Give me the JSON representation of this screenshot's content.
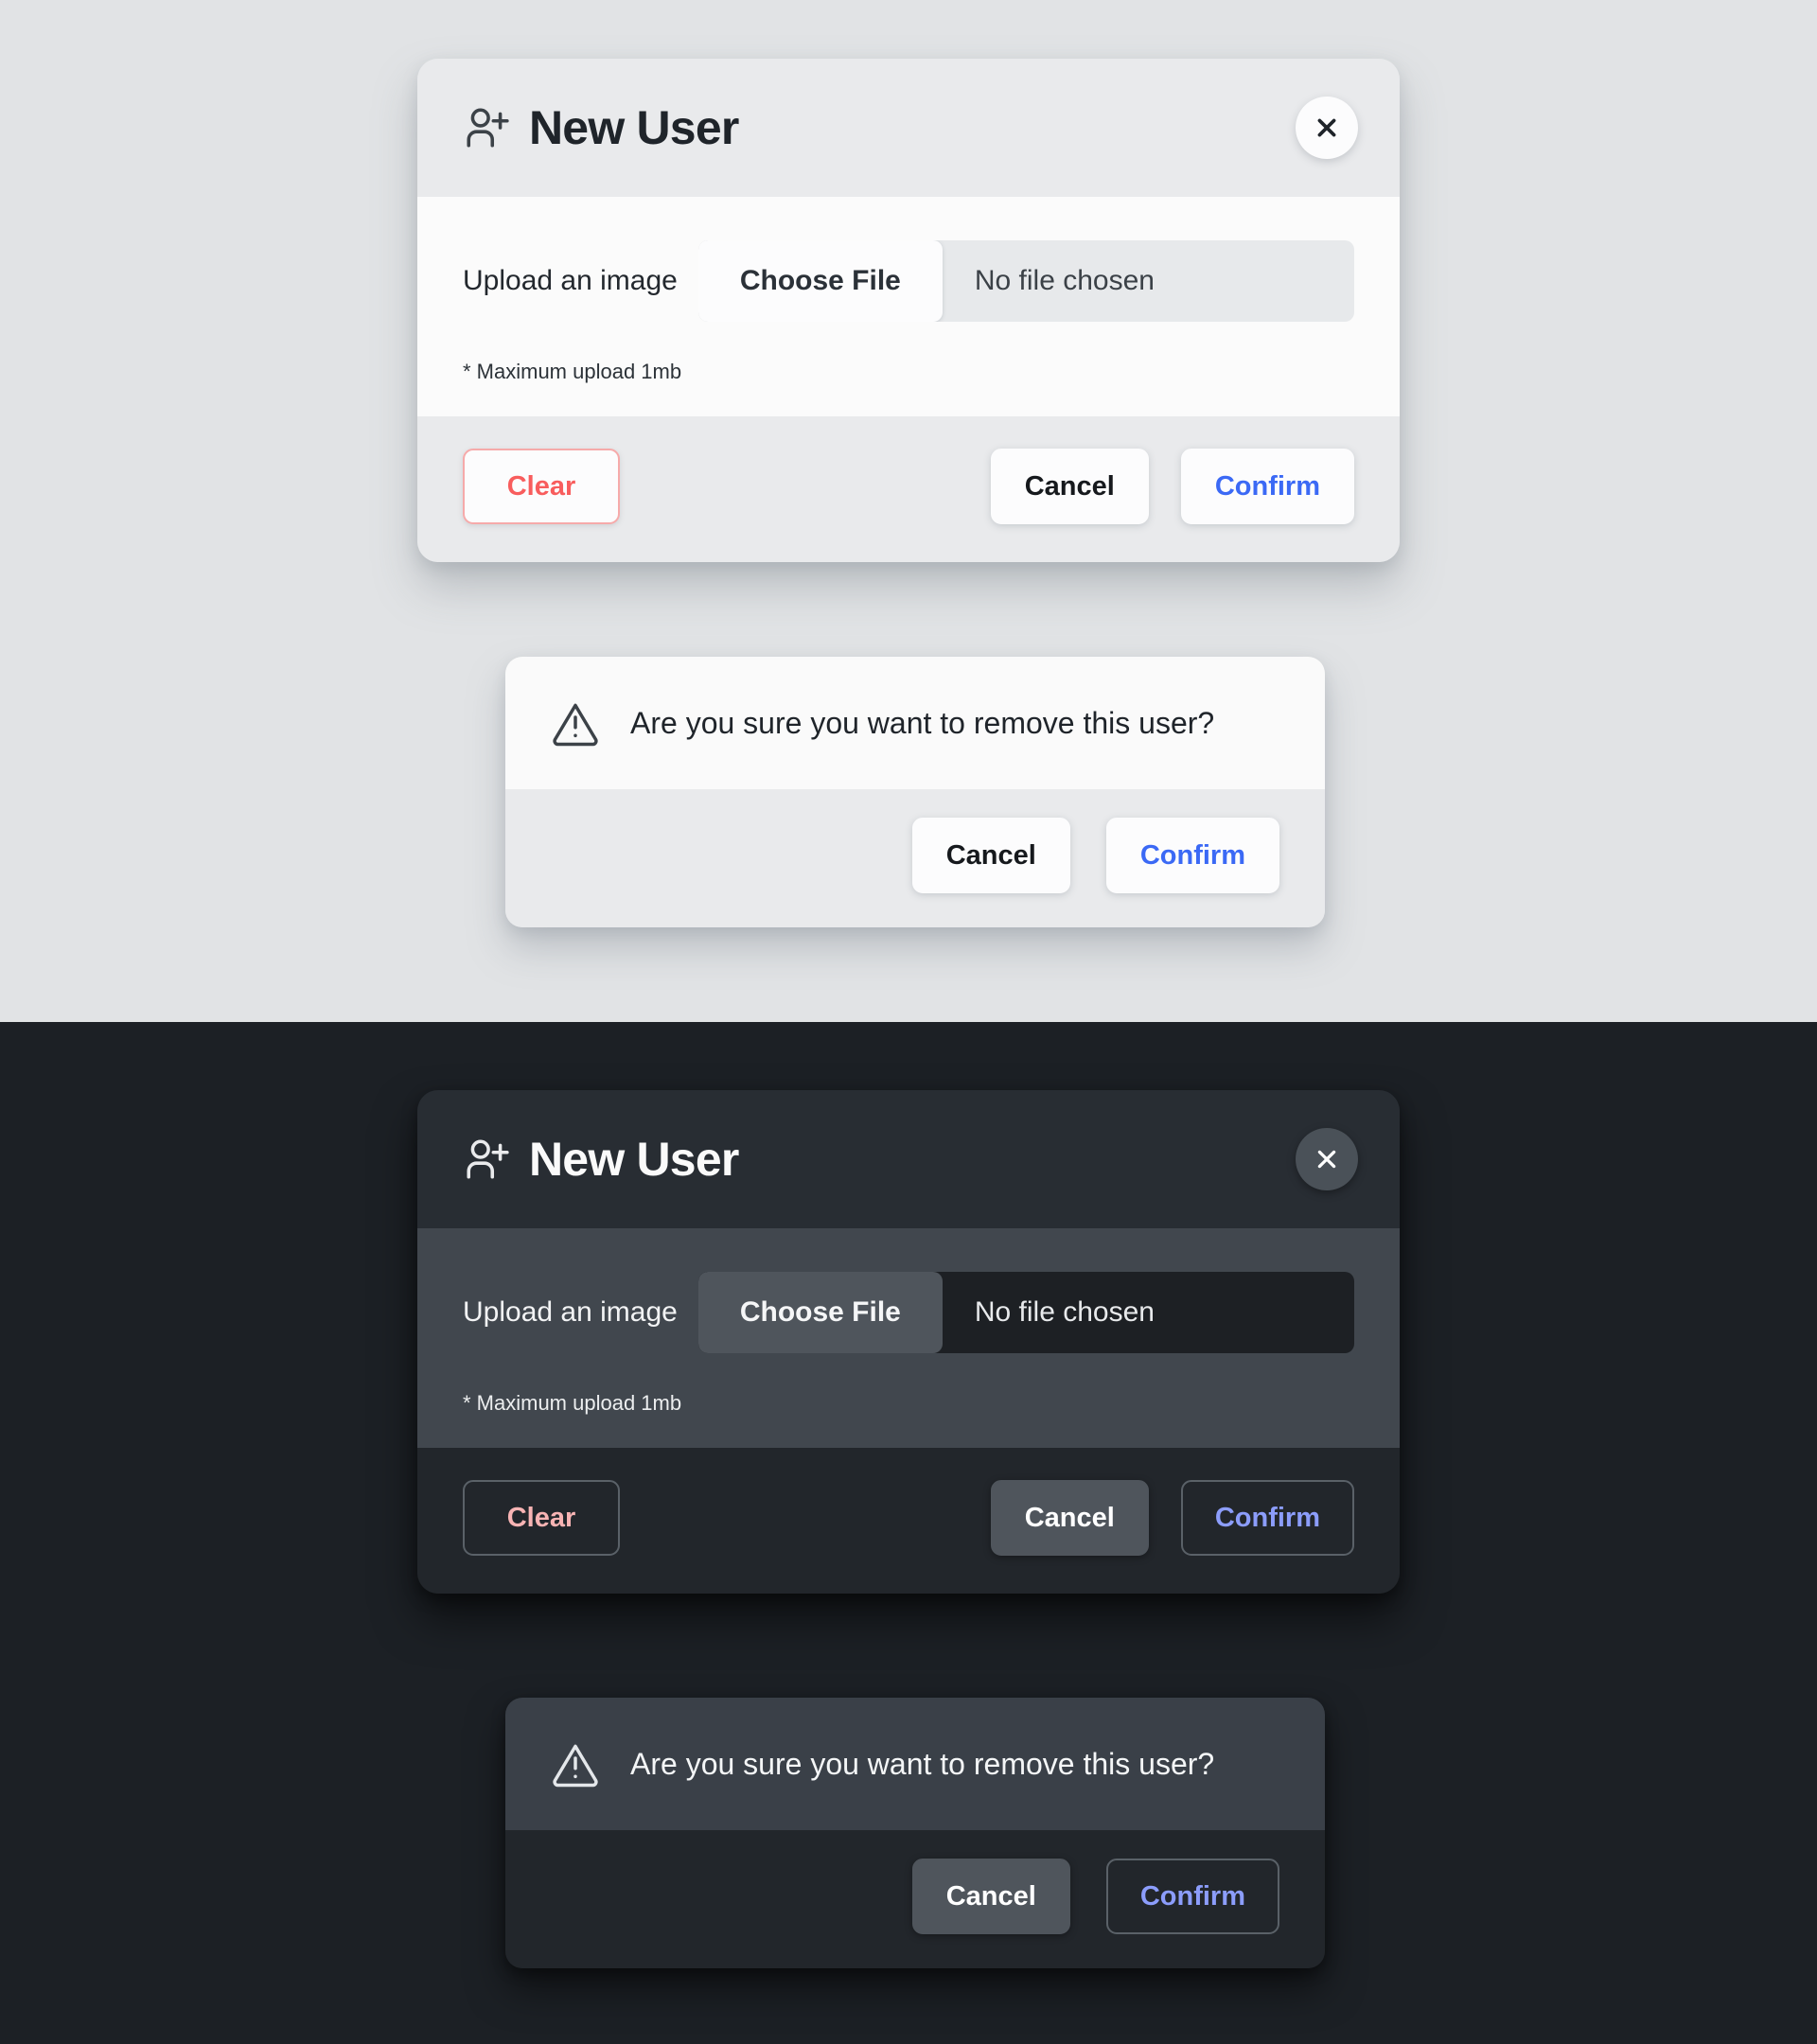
{
  "themes": {
    "light": {
      "page_background": "#e1e3e5",
      "modal": {
        "header": {
          "icon": "person-plus-icon",
          "title": "New User",
          "close_icon": "close-icon"
        },
        "body": {
          "upload_label": "Upload an image",
          "choose_file_label": "Choose File",
          "file_status": "No file chosen",
          "hint": "* Maximum upload 1mb"
        },
        "footer": {
          "clear_label": "Clear",
          "cancel_label": "Cancel",
          "confirm_label": "Confirm"
        }
      },
      "dialog": {
        "icon": "warning-triangle-icon",
        "message": "Are you sure you want to remove this user?",
        "cancel_label": "Cancel",
        "confirm_label": "Confirm"
      }
    },
    "dark": {
      "page_background": "#1c2025",
      "modal": {
        "header": {
          "icon": "person-plus-icon",
          "title": "New User",
          "close_icon": "close-icon"
        },
        "body": {
          "upload_label": "Upload an image",
          "choose_file_label": "Choose File",
          "file_status": "No file chosen",
          "hint": "* Maximum upload 1mb"
        },
        "footer": {
          "clear_label": "Clear",
          "cancel_label": "Cancel",
          "confirm_label": "Confirm"
        }
      },
      "dialog": {
        "icon": "warning-triangle-icon",
        "message": "Are you sure you want to remove this user?",
        "cancel_label": "Cancel",
        "confirm_label": "Confirm"
      }
    }
  },
  "colors": {
    "light_page_bg": "#e1e3e5",
    "light_header_bg": "#e9eaec",
    "light_body_bg": "#fbfbfb",
    "light_footer_bg": "#e9eaec",
    "dark_page_bg": "#1c2025",
    "dark_header_bg": "#282d33",
    "dark_body_bg": "#41474e",
    "dark_footer_bg": "#22262b",
    "danger_text_light": "#f85d5d",
    "danger_border_light": "#f6aaaa",
    "danger_text_dark": "#f8b4b4",
    "accent_blue_light": "#3b69f5",
    "accent_blue_dark": "#8c9dfb",
    "file_input_bg_light": "#e7e9eb",
    "file_input_bg_dark": "#1d2024",
    "choose_file_bg_dark": "#4f555c",
    "cancel_bg_dark": "#4f555c",
    "dark_dialog_body_bg": "#3a4048"
  }
}
